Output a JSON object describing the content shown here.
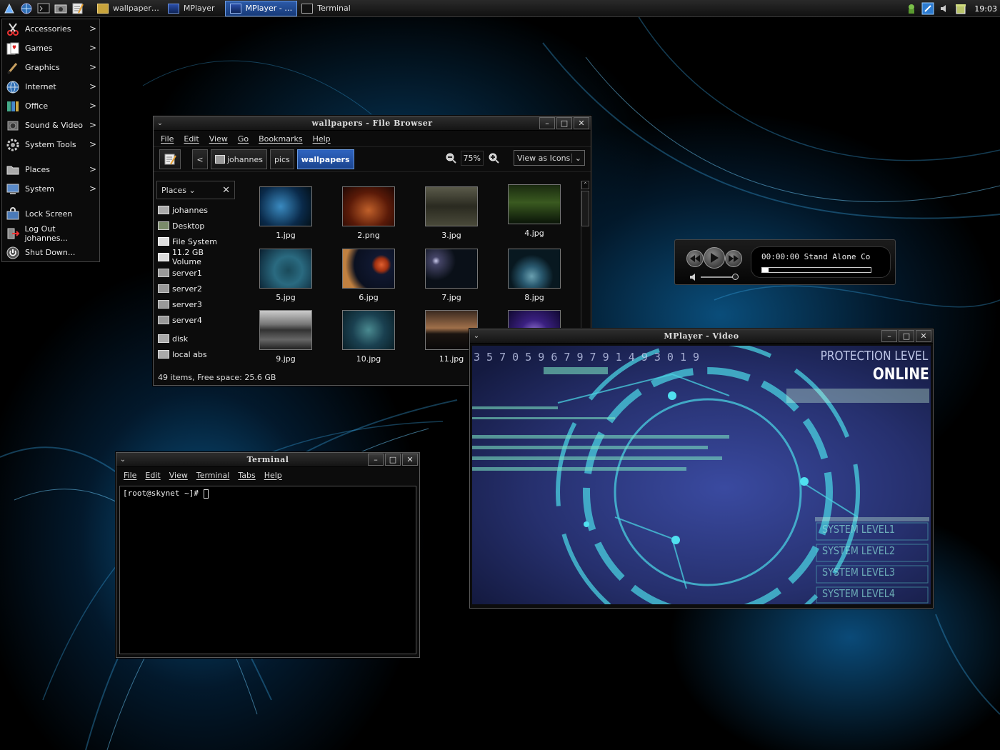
{
  "panel": {
    "tasks": [
      {
        "label": "wallpaper…",
        "active": false
      },
      {
        "label": "MPlayer",
        "active": false
      },
      {
        "label": "MPlayer - …",
        "active": true
      },
      {
        "label": "Terminal",
        "active": false
      }
    ],
    "clock": "19:03"
  },
  "menu": {
    "items": [
      {
        "label": "Accessories"
      },
      {
        "label": "Games"
      },
      {
        "label": "Graphics"
      },
      {
        "label": "Internet"
      },
      {
        "label": "Office"
      },
      {
        "label": "Sound & Video"
      },
      {
        "label": "System Tools"
      },
      {
        "label": "Places"
      },
      {
        "label": "System"
      },
      {
        "label": "Lock Screen"
      },
      {
        "label": "Log Out johannes..."
      },
      {
        "label": "Shut Down..."
      }
    ]
  },
  "filebrowser": {
    "title": "wallpapers - File Browser",
    "menu": [
      "File",
      "Edit",
      "View",
      "Go",
      "Bookmarks",
      "Help"
    ],
    "path": [
      "johannes",
      "pics",
      "wallpapers"
    ],
    "zoom": "75%",
    "view": "View as Icons",
    "sidebar_title": "Places",
    "places": [
      "johannes",
      "Desktop",
      "File System",
      "11.2 GB Volume",
      "server1",
      "server2",
      "server3",
      "server4",
      "disk",
      "local abs"
    ],
    "files": [
      "1.jpg",
      "2.png",
      "3.jpg",
      "4.jpg",
      "5.jpg",
      "6.jpg",
      "7.jpg",
      "8.jpg",
      "9.jpg",
      "10.jpg",
      "11.jpg"
    ],
    "status": "49 items, Free space: 25.6 GB"
  },
  "terminal": {
    "title": "Terminal",
    "menu": [
      "File",
      "Edit",
      "View",
      "Terminal",
      "Tabs",
      "Help"
    ],
    "prompt": "[root@skynet ~]#"
  },
  "mplayer": {
    "display": "00:00:00 Stand Alone Co",
    "progress": 0.06
  },
  "video": {
    "title": "MPlayer - Video",
    "digits": "3 5 7 0 5 9 6 7 9 7 9 1 4 9 3 0 1 9",
    "protection": "PROTECTION LEVEL",
    "online": "ONLINE",
    "levels": [
      "SYSTEM LEVEL1",
      "SYSTEM LEVEL2",
      "SYSTEM LEVEL3",
      "SYSTEM LEVEL4"
    ]
  }
}
